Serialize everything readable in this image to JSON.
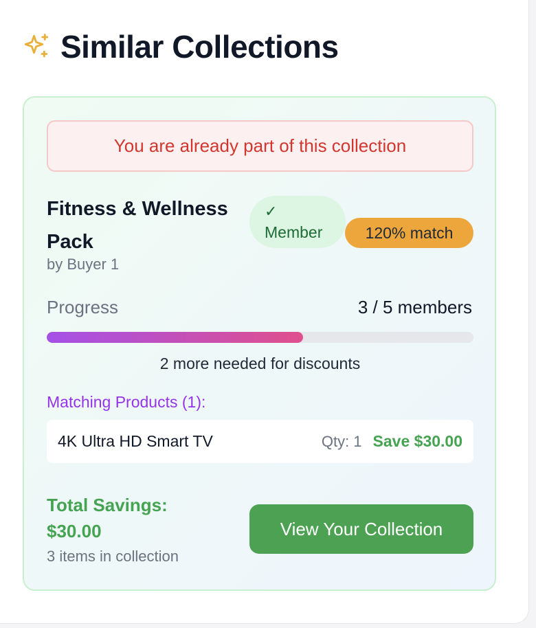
{
  "header": {
    "title": "Similar Collections",
    "icon": "sparkles-icon"
  },
  "colors": {
    "accent_green": "#4ca152",
    "alert_red": "#d2372f",
    "match_orange": "#eca63c",
    "purple": "#9333ea"
  },
  "collection": {
    "alert": "You are already part of this collection",
    "name": "Fitness & Wellness Pack",
    "owner": "by Buyer 1",
    "member_check": "✓",
    "member_badge": "Member",
    "match_badge": "120% match",
    "progress": {
      "label": "Progress",
      "count": "3 / 5 members",
      "current": 3,
      "total": 5,
      "fraction": 0.6,
      "hint": "2 more needed for discounts"
    },
    "matching_title": "Matching Products (1):",
    "products": [
      {
        "name": "4K Ultra HD Smart TV",
        "qty": "Qty: 1",
        "save": "Save $30.00"
      }
    ],
    "total_label": "Total Savings:",
    "total_value": "$30.00",
    "items_count": "3 items in collection",
    "cta": "View Your Collection"
  }
}
